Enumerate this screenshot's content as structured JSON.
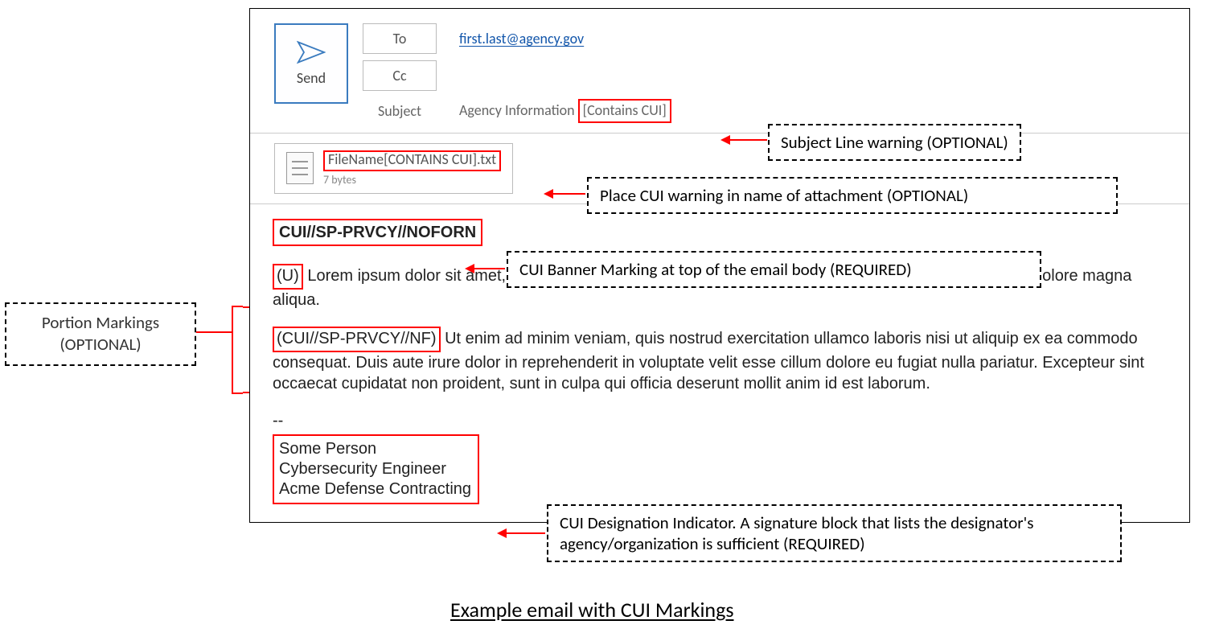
{
  "send": {
    "label": "Send"
  },
  "fields": {
    "to_label": "To",
    "cc_label": "Cc",
    "subject_label": "Subject",
    "to_value": "first.last@agency.gov",
    "subject_prefix": "Agency Information",
    "subject_cui": "[Contains CUI]"
  },
  "attachment": {
    "name": "FileName[CONTAINS CUI].txt",
    "size": "7 bytes"
  },
  "body": {
    "banner": "CUI//SP-PRVCY//NOFORN",
    "p1_mark": "(U)",
    "p1_text": " Lorem ipsum dolor sit amet, consectetur adipiscing elit, sed do eiusmod tempor incididunt ut labore et dolore magna aliqua.",
    "p2_mark": "(CUI//SP-PRVCY//NF)",
    "p2_text": " Ut enim ad minim veniam, quis nostrud exercitation ullamco laboris nisi ut aliquip ex ea commodo consequat. Duis aute irure dolor in reprehenderit in voluptate velit esse cillum dolore eu fugiat nulla pariatur. Excepteur sint occaecat cupidatat non proident, sunt in culpa qui officia deserunt mollit anim id est laborum.",
    "divider": "--",
    "sig_name": "Some Person",
    "sig_title": "Cybersecurity Engineer",
    "sig_org": "Acme Defense Contracting"
  },
  "callouts": {
    "subject": "Subject Line warning (OPTIONAL)",
    "attachment": "Place CUI warning in name of attachment (OPTIONAL)",
    "banner": "CUI Banner Marking at top of the email body (REQUIRED)",
    "signature": "CUI Designation Indicator.  A signature block that lists the designator's agency/organization is sufficient (REQUIRED)",
    "portion_l1": "Portion Markings",
    "portion_l2": "(OPTIONAL)"
  },
  "caption": "Example email with CUI Markings"
}
